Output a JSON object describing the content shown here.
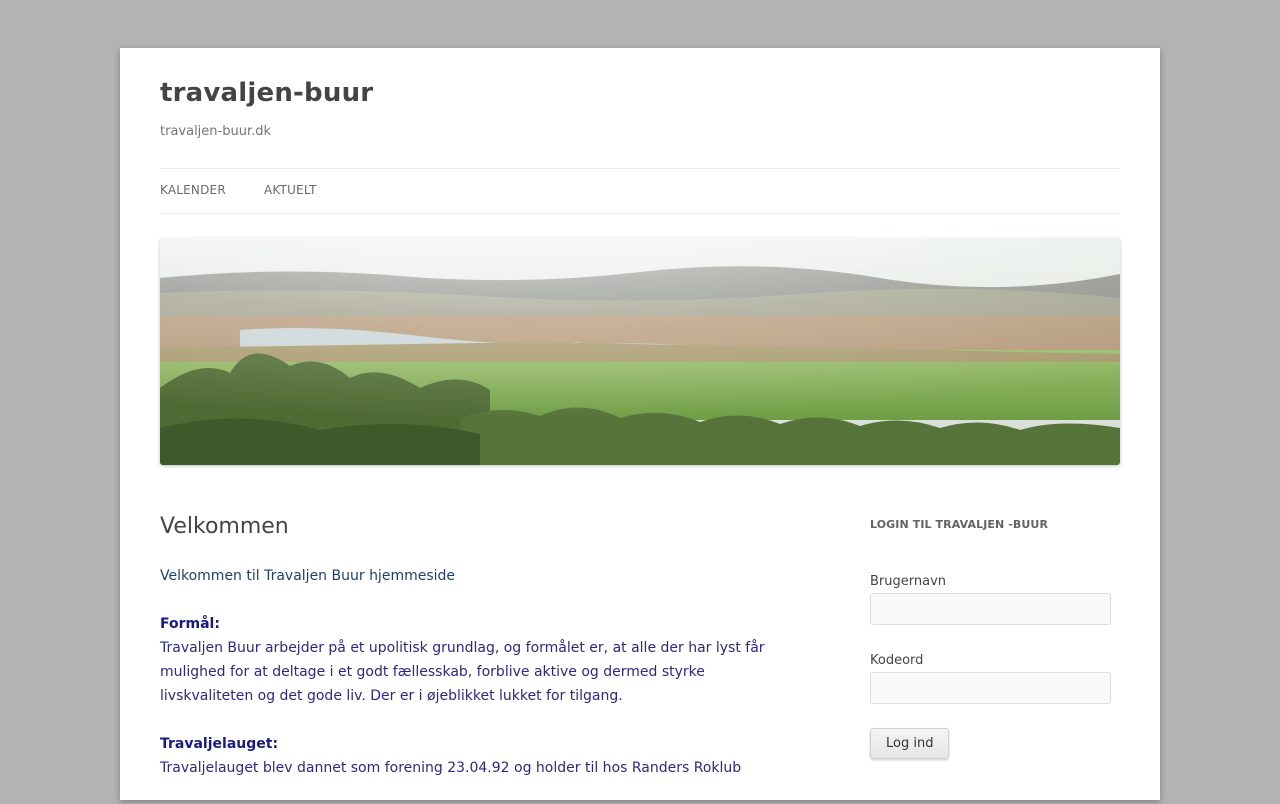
{
  "site": {
    "title": "travaljen-buur",
    "description": "travaljen-buur.dk"
  },
  "nav": {
    "items": [
      {
        "label": "KALENDER"
      },
      {
        "label": "AKTUELT"
      }
    ]
  },
  "header_image": {
    "description": "landscape banner"
  },
  "main": {
    "title": "Velkommen",
    "intro": "Velkommen til Travaljen Buur hjemmeside",
    "sections": [
      {
        "heading": "Formål:",
        "text": "Travaljen Buur arbejder på et upolitisk grundlag, og formålet er, at alle der har lyst får mulighed for at deltage i et godt fællesskab, forblive aktive og dermed styrke livskvaliteten og det gode liv. Der er i øjeblikket lukket for tilgang."
      },
      {
        "heading": "Travaljelauget:",
        "text": "Travaljelauget blev dannet som forening 23.04.92 og holder til hos Randers Roklub"
      }
    ]
  },
  "sidebar": {
    "widget_title": "LOGIN TIL TRAVALJEN -BUUR",
    "username_label": "Brugernavn",
    "username_value": "",
    "password_label": "Kodeord",
    "password_value": "",
    "login_label": "Log ind"
  },
  "colors": {
    "page_bg": "#b3b3b3",
    "content_bg": "#ffffff",
    "text_link": "#2a2a80"
  }
}
